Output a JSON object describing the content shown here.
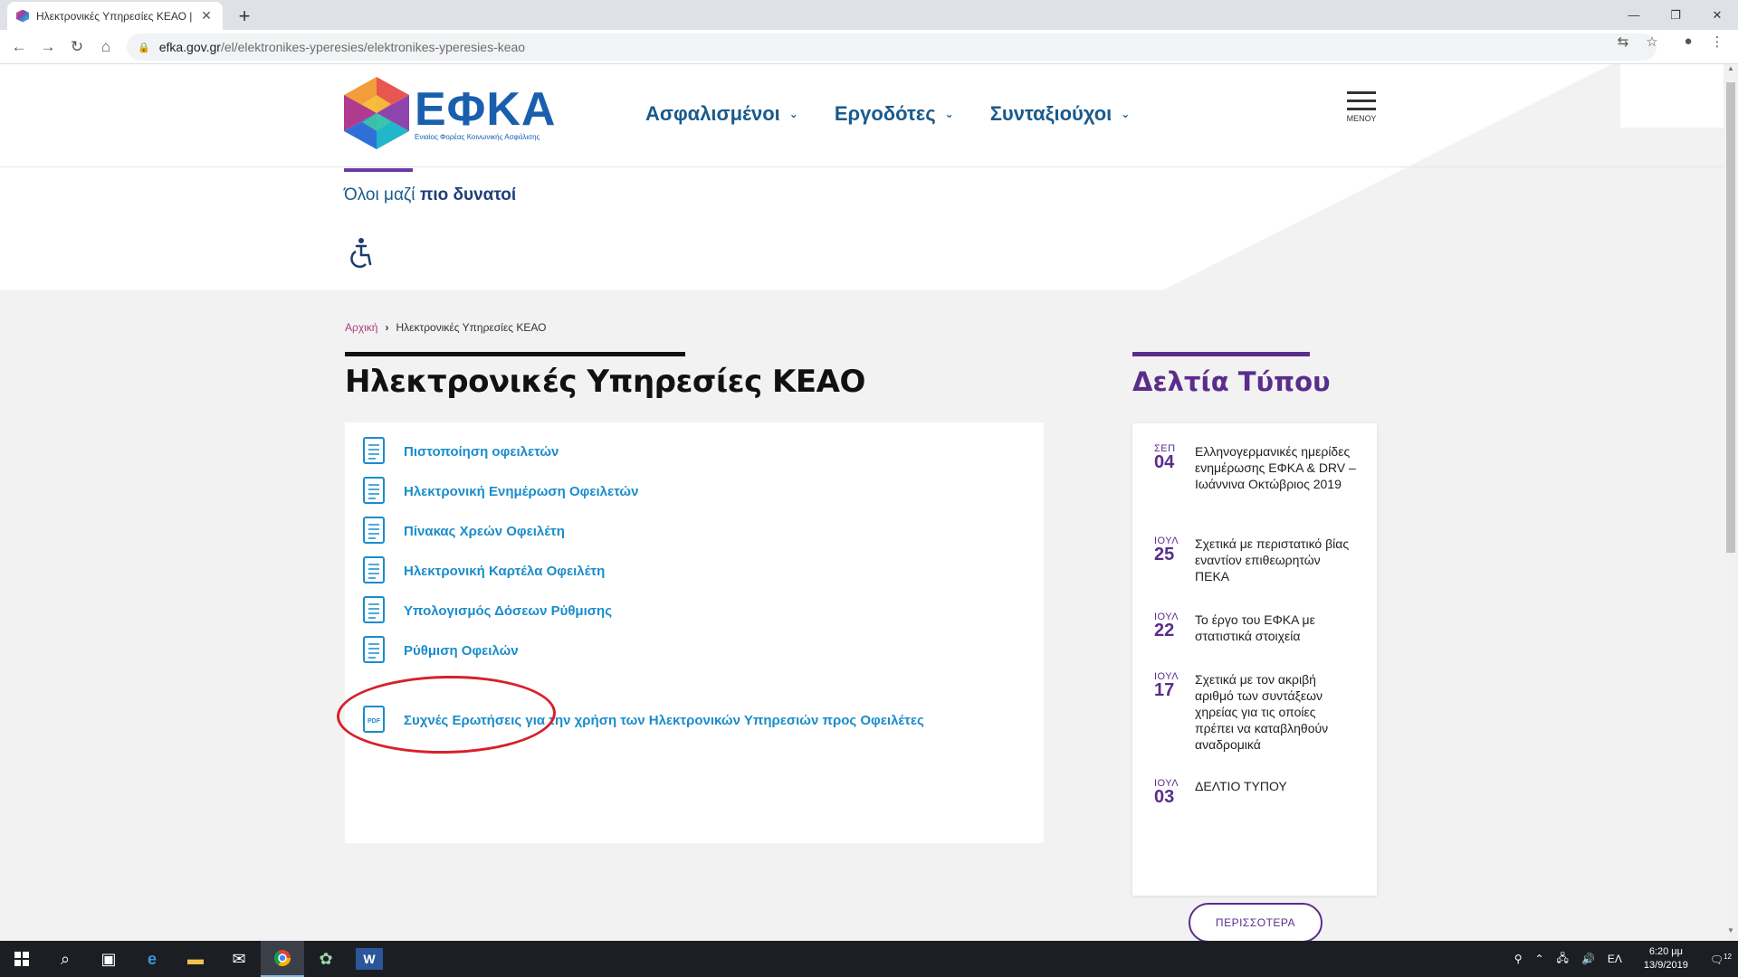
{
  "browser": {
    "tab_title": "Ηλεκτρονικές Υπηρεσίες ΚΕΑΟ |",
    "tab_close": "✕",
    "new_tab": "+",
    "url_host": "efka.gov.gr",
    "url_path": "/el/elektronikes-yperesies/elektronikes-yperesies-keao",
    "window_minimize": "—",
    "window_restore": "❐",
    "window_close": "✕"
  },
  "header": {
    "logo_text": "ΕΦΚΑ",
    "logo_subtitle": "Ενιαίος Φορέας Κοινωνικής Ασφάλισης",
    "nav": [
      "Ασφαλισμένοι",
      "Εργοδότες",
      "Συνταξιούχοι"
    ],
    "menu_label": "ΜΕΝΟΥ",
    "tagline_normal": "Όλοι μαζί ",
    "tagline_bold": "πιο δυνατοί"
  },
  "breadcrumb": {
    "home": "Αρχική",
    "separator": "›",
    "current": "Ηλεκτρονικές Υπηρεσίες ΚΕΑΟ"
  },
  "page_title": "Ηλεκτρονικές Υπηρεσίες ΚΕΑΟ",
  "services": [
    {
      "label": "Πιστοποίηση οφειλετών",
      "icon": "document-icon"
    },
    {
      "label": "Ηλεκτρονική Ενημέρωση Οφειλετών",
      "icon": "document-icon"
    },
    {
      "label": "Πίνακας Χρεών Οφειλέτη",
      "icon": "document-icon"
    },
    {
      "label": "Ηλεκτρονική Καρτέλα Οφειλέτη",
      "icon": "document-icon"
    },
    {
      "label": "Υπολογισμός Δόσεων Ρύθμισης",
      "icon": "document-icon"
    },
    {
      "label": "Ρύθμιση Οφειλών",
      "icon": "document-icon"
    },
    {
      "label": "Συχνές Ερωτήσεις για την χρήση των Ηλεκτρονικών Υπηρεσιών προς Οφειλέτες",
      "icon": "pdf-icon",
      "icon_text": "PDF"
    }
  ],
  "press": {
    "title": "Δελτία Τύπου",
    "items": [
      {
        "month": "ΣΕΠ",
        "day": "04",
        "text": "Ελληνογερμανικές ημερίδες ενημέρωσης ΕΦΚΑ & DRV – Ιωάννινα Οκτώβριος 2019"
      },
      {
        "month": "ΙΟΥΛ",
        "day": "25",
        "text": "Σχετικά με περιστατικό βίας εναντίον επιθεωρητών ΠΕΚΑ"
      },
      {
        "month": "ΙΟΥΛ",
        "day": "22",
        "text": "Το έργο του ΕΦΚΑ με στατιστικά στοιχεία"
      },
      {
        "month": "ΙΟΥΛ",
        "day": "17",
        "text": "Σχετικά με τον ακριβή αριθμό των συντάξεων χηρείας για τις οποίες πρέπει να καταβληθούν αναδρομικά"
      },
      {
        "month": "ΙΟΥΛ",
        "day": "03",
        "text": "ΔΕΛΤΙΟ ΤΥΠΟΥ"
      }
    ],
    "more_label": "ΠΕΡΙΣΣΟΤΕΡΑ"
  },
  "taskbar": {
    "language": "ΕΛ",
    "time": "6:20 μμ",
    "date": "13/9/2019",
    "notification_count": "12"
  },
  "colors": {
    "brand_blue": "#1a5a8c",
    "link_blue": "#1a8ccc",
    "purple": "#5a2d8c",
    "highlight_red": "#d7202a"
  }
}
